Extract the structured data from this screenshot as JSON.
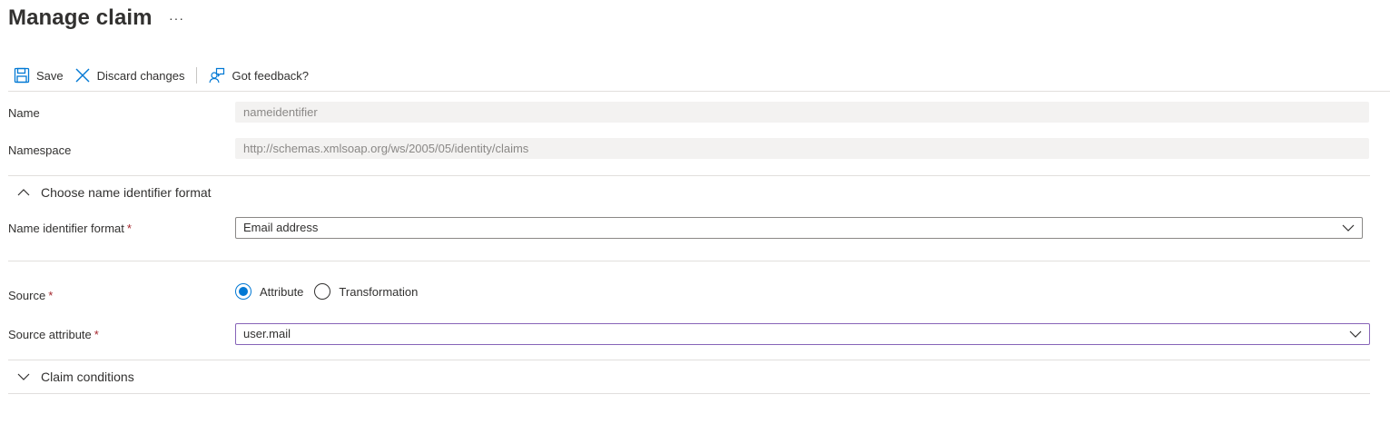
{
  "header": {
    "title": "Manage claim",
    "more_label": "···"
  },
  "toolbar": {
    "save_label": "Save",
    "discard_label": "Discard changes",
    "feedback_label": "Got feedback?"
  },
  "fields": {
    "name_label": "Name",
    "name_value": "nameidentifier",
    "namespace_label": "Namespace",
    "namespace_value": "http://schemas.xmlsoap.org/ws/2005/05/identity/claims"
  },
  "name_format_section": {
    "title": "Choose name identifier format",
    "format_label": "Name identifier format",
    "format_value": "Email address"
  },
  "source": {
    "label": "Source",
    "options": [
      "Attribute",
      "Transformation"
    ],
    "selected": "Attribute",
    "attribute_label": "Source attribute",
    "attribute_value": "user.mail"
  },
  "conditions_section": {
    "title": "Claim conditions"
  },
  "required_marker": "*",
  "colors": {
    "accent": "#0078d4",
    "required": "#a4262c",
    "focus_border": "#8764b8"
  }
}
